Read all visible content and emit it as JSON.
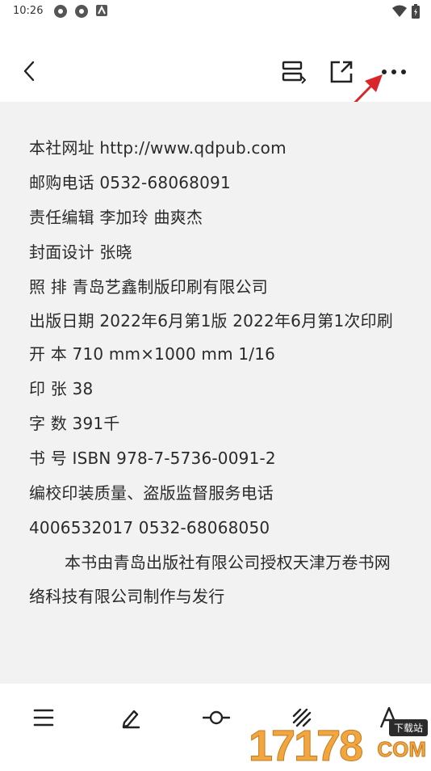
{
  "status_bar": {
    "time": "10:26"
  },
  "toolbar": {
    "back_icon": "chevron-left-icon",
    "toc_icon": "toc-switch-icon",
    "share_icon": "share-icon",
    "more_icon": "more-horizontal-icon",
    "annotation_color": "#d9262b"
  },
  "page": {
    "lines": [
      "本社网址 http://www.qdpub.com",
      "邮购电话 0532-68068091",
      "责任编辑 李加玲 曲爽杰",
      "封面设计 张晓",
      "照 排 青岛艺鑫制版印刷有限公司",
      "出版日期  2022年6月第1版  2022年6月第1次印刷",
      "开 本 710 mm×1000 mm 1/16",
      "印 张 38",
      "字 数 391千",
      "书 号 ISBN 978-7-5736-0091-2",
      "编校印装质量、盗版监督服务电话",
      "4006532017 0532-68068050",
      "本书由青岛出版社有限公司授权天津万卷书网络科技有限公司制作与发行"
    ]
  },
  "bottom_bar": {
    "items": [
      {
        "icon": "menu-icon"
      },
      {
        "icon": "pencil-icon"
      },
      {
        "icon": "progress-slider-icon"
      },
      {
        "icon": "brightness-icon"
      },
      {
        "icon": "font-icon"
      }
    ]
  },
  "watermark": {
    "main": "17178",
    "badge": "下载站",
    "suffix": "COM"
  }
}
